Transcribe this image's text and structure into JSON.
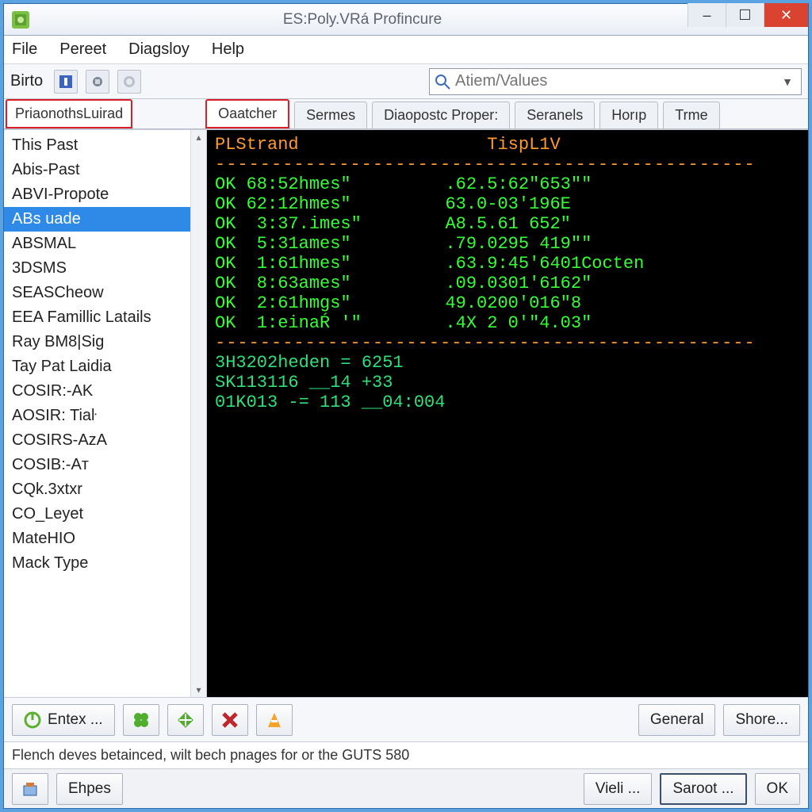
{
  "window": {
    "title": "ES:Poly.VRá Profincure"
  },
  "menu": {
    "items": [
      "File",
      "Pereet",
      "Diagsloy",
      "Help"
    ]
  },
  "toolbar": {
    "label": "Birto",
    "search_placeholder": "Atiem/Values"
  },
  "tabs": [
    {
      "label": "PriaonothsLuirad",
      "boxed": true
    },
    {
      "label": "Oaatcher",
      "boxed": true
    },
    {
      "label": "Sermes"
    },
    {
      "label": "Diaopostc Proper:"
    },
    {
      "label": "Seranels"
    },
    {
      "label": "Horıp"
    },
    {
      "label": "Trme"
    }
  ],
  "sidebar": {
    "items": [
      "This Past",
      "Abis-Past",
      "ABVI-Propote",
      "ABs uade",
      "ABSMAL",
      "3DSMS",
      "SEASCheow",
      "EEA Famillic Latails",
      "Ray BM8|Sig",
      "Tay Pat Laidia",
      "COSIR:-AK",
      "AOSIR: Tiaŀ",
      "COSIRS-AzA",
      "COSIB:-Aт",
      "CQk.3xtxr",
      "CO_Leyet",
      "MateHIO",
      "Mack Type"
    ],
    "selected_index": 3
  },
  "terminal": {
    "header_left": "PLStrand",
    "header_right": "TispL1V",
    "rows": [
      {
        "c1": "OK 68:52hmes\"",
        "c2": ".62.5:62\"653\"\""
      },
      {
        "c1": "OK 62:12hmes\"",
        "c2": "63.0-03'196E"
      },
      {
        "c1": "OK  3:37.imes\"",
        "c2": "A8.5.61 652\""
      },
      {
        "c1": "OK  5:31ames\"",
        "c2": ".79.0295 419\"\""
      },
      {
        "c1": "OK  1:61hmes\"",
        "c2": ".63.9:45'6401Cocten"
      },
      {
        "c1": "OK  8:63ames\"",
        "c2": ".09.0301'6162\""
      },
      {
        "c1": "OK  2:61hmgs\"",
        "c2": "49.0200'016\"8"
      },
      {
        "c1": "OK  1:einaŔ '\"",
        "c2": ".4X 2 0'\"4.03\""
      }
    ],
    "summary": [
      "3H3202heden = 6251",
      "SK113116 __14 +33",
      "01K013 -= 113 __04:004"
    ]
  },
  "action_buttons": {
    "entex": "Entex ...",
    "general": "General",
    "shore": "Shore..."
  },
  "status": "Flench deves betainced, wilt bech pnages for or the GUTS 580",
  "footer": {
    "ehpes": "Ehpes",
    "vieli": "Vieli ...",
    "saroot": "Saroot ...",
    "ok": "OK"
  },
  "colors": {
    "accent_blue": "#2e8ae6",
    "danger_red": "#d9432f",
    "term_green": "#33ff33",
    "term_orange": "#ff9a2e"
  }
}
